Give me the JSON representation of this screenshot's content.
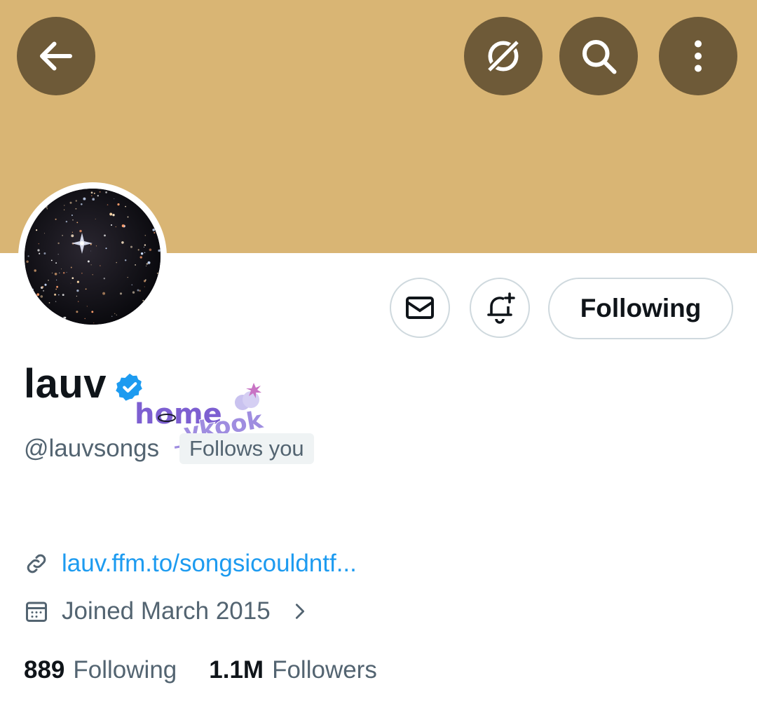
{
  "colors": {
    "banner": "#d9b574",
    "button_bg": "#6e5a38",
    "accent": "#1d9bf0",
    "muted": "#536471"
  },
  "header": {
    "back_icon": "arrow-left-icon",
    "grok_icon": "grok-icon",
    "search_icon": "search-icon",
    "more_icon": "more-vertical-icon"
  },
  "actions": {
    "message_icon": "envelope-icon",
    "notify_icon": "bell-plus-icon",
    "following_label": "Following"
  },
  "profile": {
    "display_name": "lauv",
    "verified": true,
    "handle": "@lauvsongs",
    "follows_you": "Follows you",
    "watermark_line1": "home",
    "watermark_line2": "_vkook",
    "link": "lauv.ffm.to/songsicouldntf...",
    "joined": "Joined March 2015"
  },
  "stats": {
    "following_count": "889",
    "following_label": "Following",
    "followers_count": "1.1M",
    "followers_label": "Followers"
  }
}
